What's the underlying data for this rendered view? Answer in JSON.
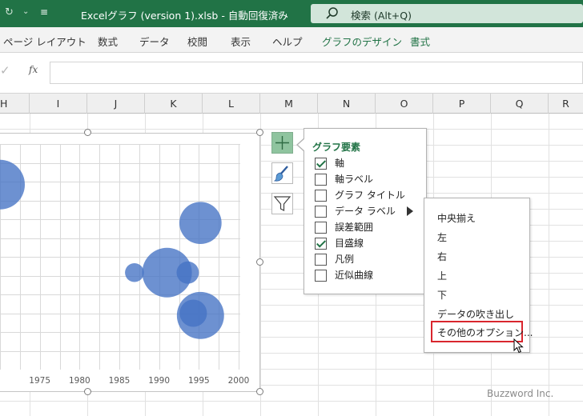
{
  "titlebar": {
    "filename": "Excelグラフ (version 1).xlsb",
    "separator": "-",
    "autosave": "自動回復済み",
    "caret": "⌄",
    "search_placeholder": "検索 (Alt+Q)"
  },
  "ribbon": {
    "tabs": [
      {
        "label": "ページ レイアウト"
      },
      {
        "label": "数式"
      },
      {
        "label": "データ"
      },
      {
        "label": "校閲"
      },
      {
        "label": "表示"
      },
      {
        "label": "ヘルプ"
      },
      {
        "label": "グラフのデザイン"
      },
      {
        "label": "書式"
      }
    ]
  },
  "formula_bar": {
    "fx_label": "fx",
    "value": ""
  },
  "columns": [
    "H",
    "I",
    "J",
    "K",
    "L",
    "M",
    "N",
    "O",
    "P",
    "Q",
    "R"
  ],
  "chart_data": {
    "type": "scatter",
    "subtype": "bubble",
    "x_tick_labels": [
      "1975",
      "1980",
      "1985",
      "1990",
      "1995",
      "2000"
    ],
    "xlim": [
      1970,
      2000
    ],
    "grid": true,
    "color": "#4472c4",
    "bubbles": [
      {
        "x": 1970,
        "y": 0.82,
        "size": 1.0
      },
      {
        "x": 1995.2,
        "y": 0.65,
        "size": 0.85
      },
      {
        "x": 1986.9,
        "y": 0.43,
        "size": 0.38
      },
      {
        "x": 1991.0,
        "y": 0.43,
        "size": 1.0
      },
      {
        "x": 1993.6,
        "y": 0.43,
        "size": 0.45
      },
      {
        "x": 1995.2,
        "y": 0.24,
        "size": 0.95
      },
      {
        "x": 1994.3,
        "y": 0.25,
        "size": 0.55
      }
    ]
  },
  "chart_elements_panel": {
    "title": "グラフ要素",
    "items": [
      {
        "label": "軸",
        "checked": true
      },
      {
        "label": "軸ラベル",
        "checked": false
      },
      {
        "label": "グラフ タイトル",
        "checked": false
      },
      {
        "label": "データ ラベル",
        "checked": false
      },
      {
        "label": "誤差範囲",
        "checked": false
      },
      {
        "label": "目盛線",
        "checked": true
      },
      {
        "label": "凡例",
        "checked": false
      },
      {
        "label": "近似曲線",
        "checked": false
      }
    ]
  },
  "data_label_submenu": {
    "items": [
      {
        "label": "中央揃え"
      },
      {
        "label": "左"
      },
      {
        "label": "右"
      },
      {
        "label": "上"
      },
      {
        "label": "下"
      },
      {
        "label": "データの吹き出し"
      },
      {
        "label": "その他のオプション..."
      }
    ],
    "highlighted_index": 6
  },
  "side_buttons": {
    "chart_elements_icon": "plus-icon",
    "chart_styles_icon": "brush-icon",
    "chart_filters_icon": "funnel-icon"
  },
  "watermark": "Buzzword Inc.",
  "colors": {
    "excel_green": "#217346",
    "bubble_blue": "#4472c4",
    "highlight_red": "#d9262e"
  }
}
